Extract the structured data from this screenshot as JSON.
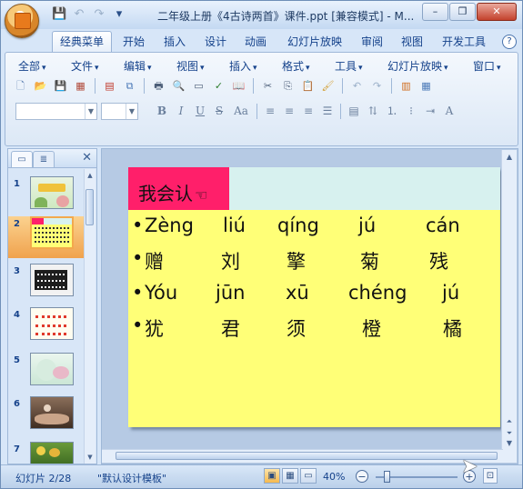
{
  "window": {
    "title": "二年级上册《4古诗两首》课件.ppt [兼容模式] - M...",
    "min_label": "–",
    "max_label": "❐",
    "close_label": "✕"
  },
  "quick_access": {
    "save_icon": "💾",
    "undo_icon": "↶",
    "redo_icon": "↷",
    "customize_icon": "▾"
  },
  "tabs": [
    {
      "label": "经典菜单"
    },
    {
      "label": "开始"
    },
    {
      "label": "插入"
    },
    {
      "label": "设计"
    },
    {
      "label": "动画"
    },
    {
      "label": "幻灯片放映"
    },
    {
      "label": "审阅"
    },
    {
      "label": "视图"
    },
    {
      "label": "开发工具"
    }
  ],
  "help_label": "?",
  "menus": [
    {
      "label": "全部"
    },
    {
      "label": "文件"
    },
    {
      "label": "编辑"
    },
    {
      "label": "视图"
    },
    {
      "label": "插入"
    },
    {
      "label": "格式"
    },
    {
      "label": "工具"
    },
    {
      "label": "幻灯片放映"
    },
    {
      "label": "窗口"
    }
  ],
  "format_buttons": {
    "bold": "B",
    "italic": "I",
    "underline": "U",
    "strike": "S",
    "case": "Aa"
  },
  "slides_panel": {
    "close_label": "✕",
    "numbers": [
      "1",
      "2",
      "3",
      "4",
      "5",
      "6",
      "7"
    ],
    "selected_index": 2
  },
  "slide": {
    "header_label": "我会认",
    "header_icon": "☜",
    "row1": {
      "bullet": "•",
      "cells": [
        "Zèng",
        "liú",
        "qíng",
        "jú",
        "cán"
      ]
    },
    "row2": {
      "bullet": "•",
      "cells": [
        "赠",
        "刘",
        "擎",
        "菊",
        "残"
      ]
    },
    "row3": {
      "bullet": "•",
      "cells": [
        "Yóu",
        "jūn",
        "xū",
        "chéng",
        "jú"
      ]
    },
    "row4": {
      "bullet": "•",
      "cells": [
        "犹",
        "君",
        "须",
        "橙",
        "橘"
      ]
    }
  },
  "status": {
    "slide_info": "幻灯片 2/28",
    "template": "\"默认设计模板\"",
    "zoom": "40%",
    "zoom_out": "−",
    "zoom_in": "+",
    "fit_label": "⊡"
  },
  "colors": {
    "slide_bg": "#ffff77",
    "header_band": "#d7f1ef",
    "header_badge": "#ff1f6a"
  }
}
